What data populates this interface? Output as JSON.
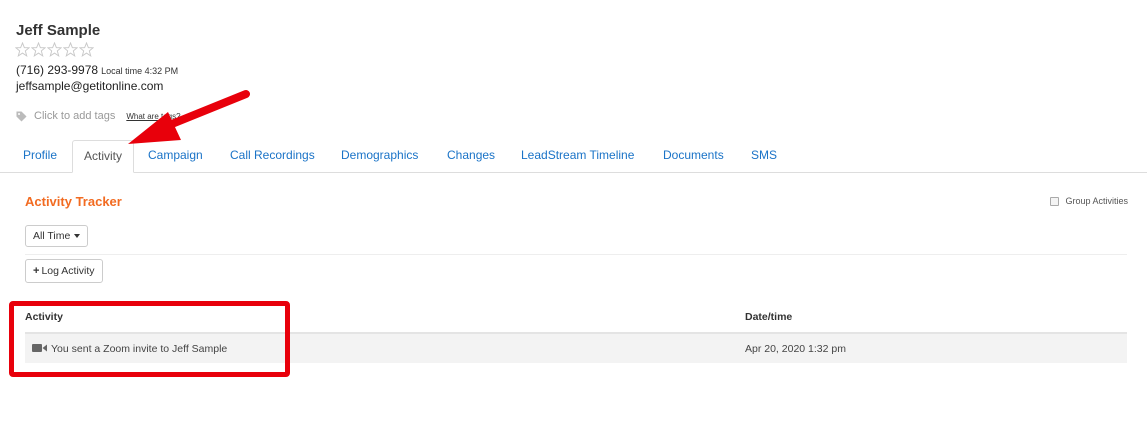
{
  "contact": {
    "name": "Jeff Sample",
    "rating": 0,
    "rating_max": 5,
    "phone": "(716) 293-9978",
    "local_time": "Local time 4:32 PM",
    "email": "jeffsample@getitonline.com",
    "tags_placeholder": "Click to add tags",
    "tags_help": "What are tags?"
  },
  "tabs": [
    {
      "label": "Profile"
    },
    {
      "label": "Activity"
    },
    {
      "label": "Campaign"
    },
    {
      "label": "Call Recordings"
    },
    {
      "label": "Demographics"
    },
    {
      "label": "Changes"
    },
    {
      "label": "LeadStream Timeline"
    },
    {
      "label": "Documents"
    },
    {
      "label": "SMS"
    }
  ],
  "active_tab": "Activity",
  "activity": {
    "title": "Activity Tracker",
    "group_label": "Group Activities",
    "group_checked": false,
    "filter_label": "All Time",
    "log_button_label": "Log Activity",
    "columns": [
      "Activity",
      "Date/time"
    ],
    "rows": [
      {
        "icon": "video-camera-icon",
        "text": "You sent a Zoom invite to Jeff Sample",
        "datetime": "Apr 20, 2020 1:32 pm"
      }
    ]
  },
  "colors": {
    "accent_orange": "#f26b21",
    "link_blue": "#1a73c7",
    "annotation_red": "#e8000b"
  }
}
